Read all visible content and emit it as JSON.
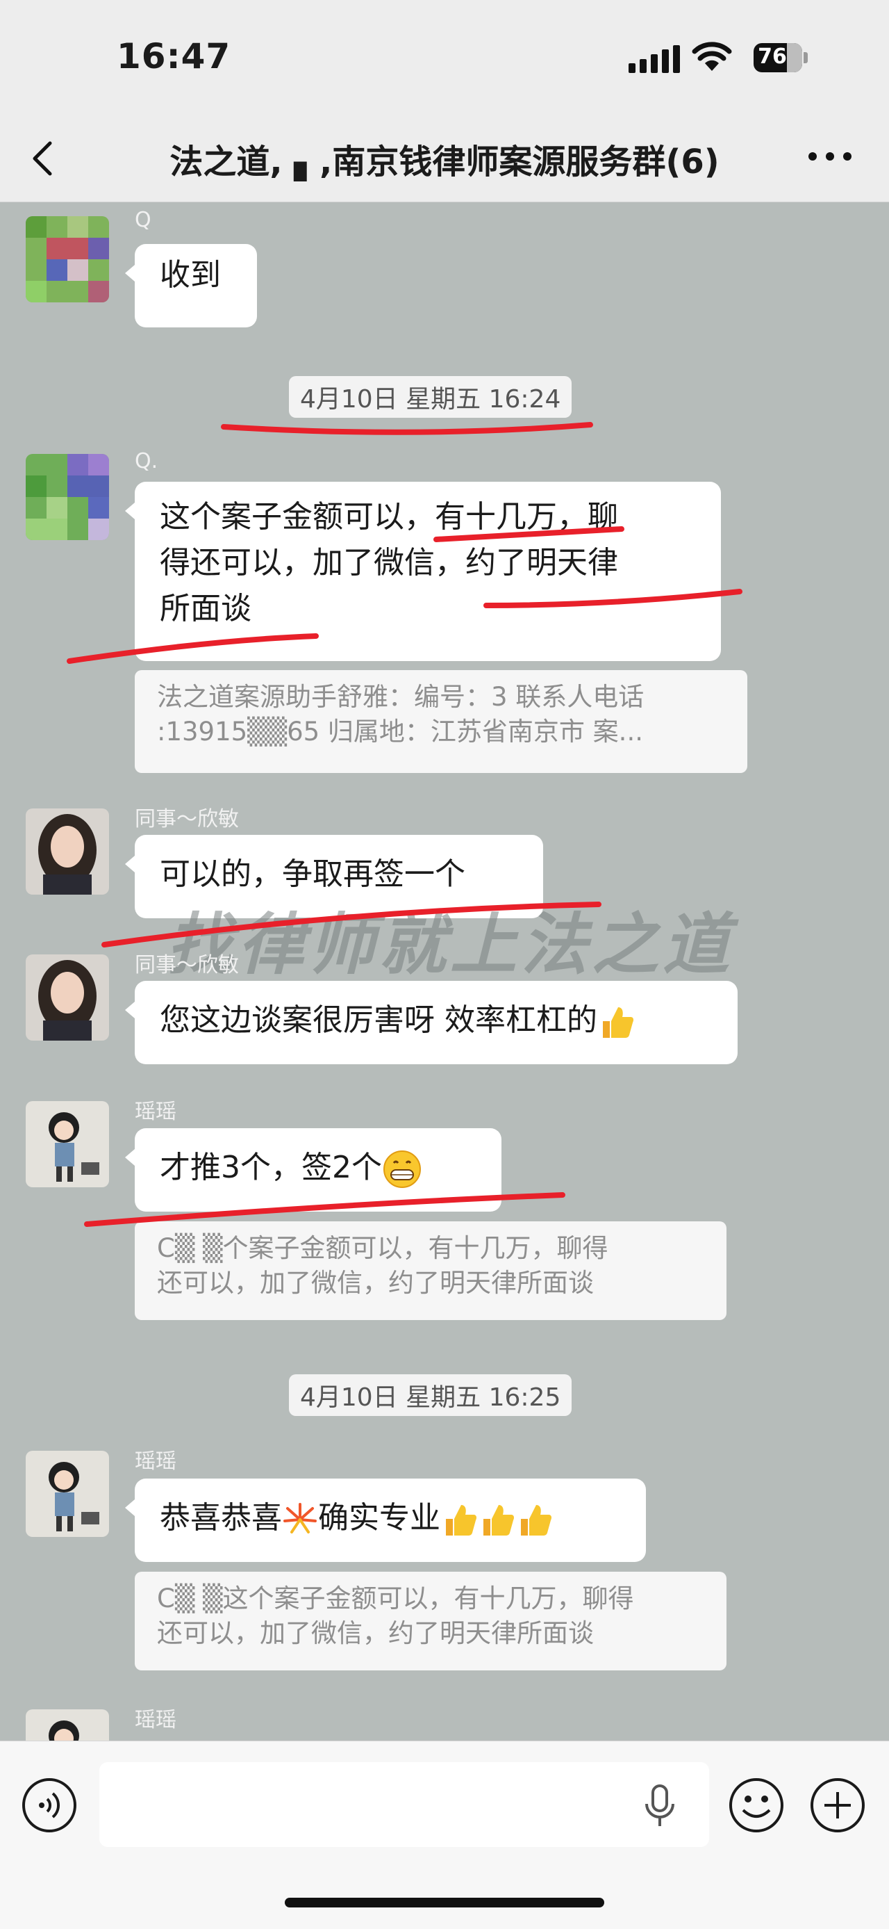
{
  "status_bar": {
    "time": "16:47",
    "battery": "76"
  },
  "header": {
    "title": "法之道, ▖,南京钱律师案源服务群(6)"
  },
  "watermark": "找律师就上法之道",
  "messages": {
    "m1": {
      "sender": "Q",
      "text": "收到"
    },
    "stamp1": "4月10日 星期五 16:24",
    "m2": {
      "sender": "Q.",
      "line1": "这个案子金额可以，有十几万，聊",
      "line2": "得还可以，加了微信，约了明天律",
      "line3": "所面谈",
      "quote1": "法之道案源助手舒雅：编号：3 联系人电话",
      "quote2": ":13915▒▒65 归属地：江苏省南京市 案..."
    },
    "m3": {
      "sender": "同事～欣敏",
      "text": "可以的，争取再签一个"
    },
    "m4": {
      "sender": "同事～欣敏",
      "text": "您这边谈案很厉害呀 效率杠杠的"
    },
    "m5": {
      "sender": "瑶瑶",
      "text": "才推3个，签2个",
      "quote1": "C▒ ▒个案子金额可以，有十几万，聊得",
      "quote2": "还可以，加了微信，约了明天律所面谈"
    },
    "stamp2": "4月10日 星期五 16:25",
    "m6": {
      "sender": "瑶瑶",
      "text": "恭喜恭喜",
      "text2": "确实专业",
      "quote1": "C▒ ▒这个案子金额可以，有十几万，聊得",
      "quote2": "还可以，加了微信，约了明天律所面谈"
    },
    "m7": {
      "sender": "瑶瑶"
    }
  },
  "icons": {
    "back": "chevron-left-icon",
    "more": "more-dots-icon",
    "voice": "voice-icon",
    "mic": "microphone-icon",
    "emoji": "smile-icon",
    "plus": "plus-icon",
    "thumbs": "thumbs-up-emoji",
    "grin": "grin-emoji",
    "firework": "firework-emoji"
  },
  "colors": {
    "chat_bg": "#b6bcba",
    "annotation_red": "#e8202a",
    "bubble": "#ffffff"
  }
}
